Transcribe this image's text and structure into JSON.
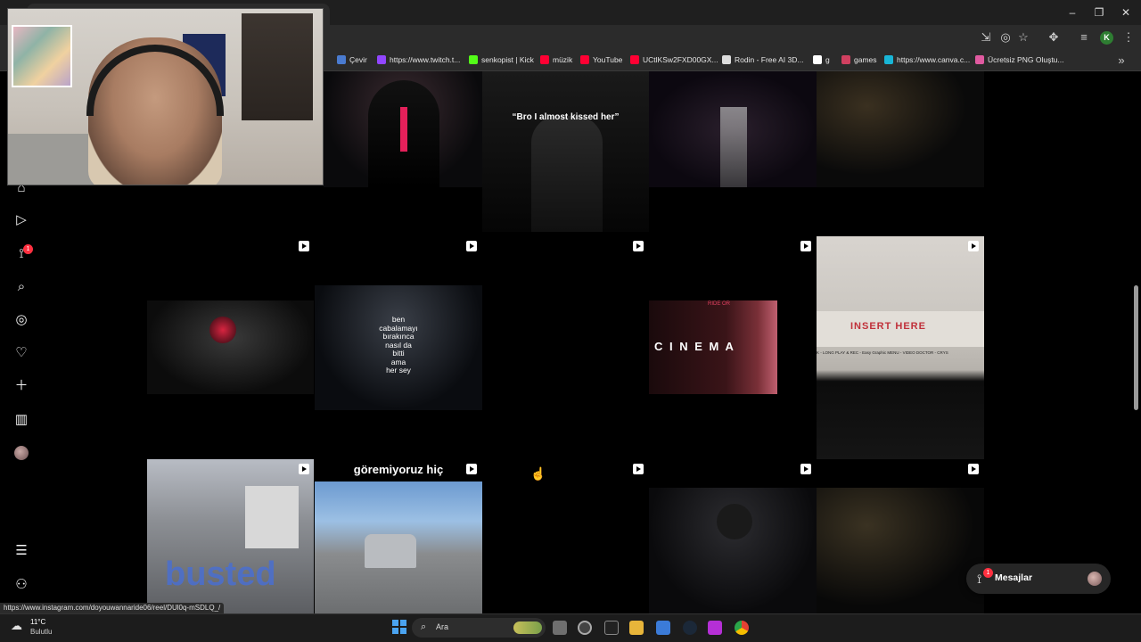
{
  "browser": {
    "bookmarks": [
      {
        "label": "Çevir",
        "color": "#4a7bd0"
      },
      {
        "label": "https://www.twitch.t...",
        "color": "#9146ff"
      },
      {
        "label": "senkopist | Kick",
        "color": "#53fc18"
      },
      {
        "label": "müzik",
        "color": "#ff0033"
      },
      {
        "label": "YouTube",
        "color": "#ff0033"
      },
      {
        "label": "UCtlKSw2FXD00GX...",
        "color": "#ff0033"
      },
      {
        "label": "Rodin - Free AI 3D...",
        "color": "#dddddd"
      },
      {
        "label": "g",
        "color": "#ffffff"
      },
      {
        "label": "games",
        "color": "#d04060"
      },
      {
        "label": "https://www.canva.c...",
        "color": "#18b5d6"
      },
      {
        "label": "Ücretsiz PNG Oluştu...",
        "color": "#e05aa0"
      }
    ],
    "profile_initial": "K",
    "status_url": "https://www.instagram.com/doyouwannaride06/reel/DUl0q-mSDLQ_/"
  },
  "instagram": {
    "notification_count": "1",
    "tiles": {
      "t2_caption": "“Bro I almost kissed her”",
      "t6_caption": "ben\ncabalamayı\nbırakınca\nnasıl da\nbitti\nama\nher sey",
      "t8_caption": "C I N E M A",
      "t8_small": "RIDE OR",
      "t9_caption": "INSERT HERE",
      "t9_ticker": "K - LONG PLAY & REC - Easy Graphic MENU - VIDEO DOCTOR - CRYS",
      "t10_caption": "busted",
      "t11_caption": "göremiyoruz hiç"
    },
    "messages": {
      "label": "Mesajlar",
      "badge": "1"
    }
  },
  "taskbar": {
    "weather_temp": "11°C",
    "weather_desc": "Bulutlu",
    "search_placeholder": "Ara"
  },
  "colors": {
    "accent_red": "#ff3040",
    "chrome_bg": "#2b2b2b"
  }
}
